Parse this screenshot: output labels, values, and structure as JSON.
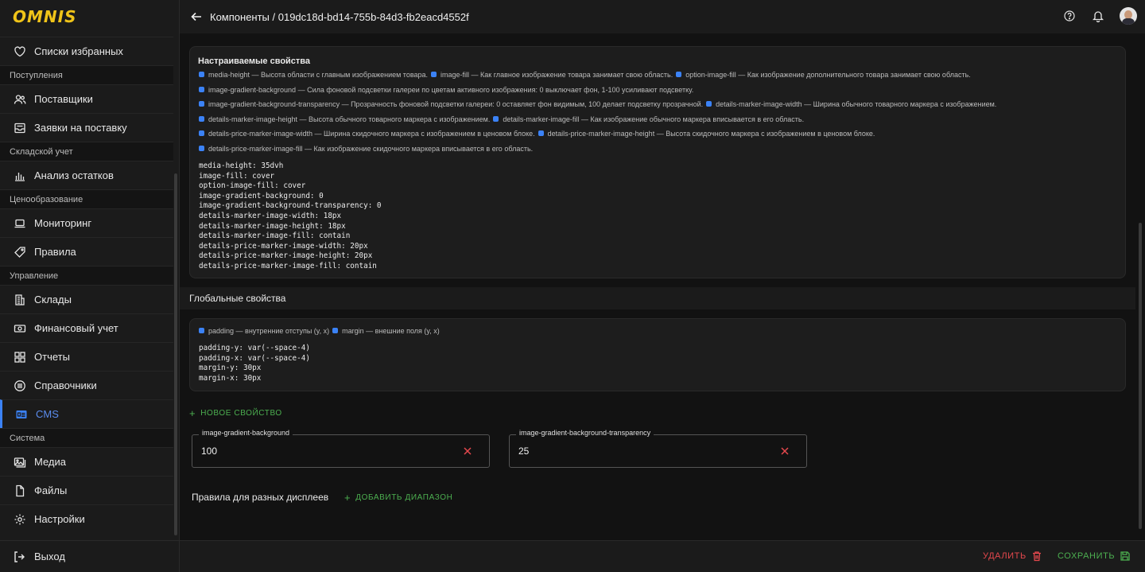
{
  "app": {
    "logo": "OMNIS"
  },
  "header": {
    "breadcrumb": "Компоненты / 019dc18d-bd14-755b-84d3-fb2eacd4552f",
    "icons": [
      "arrow-left-icon",
      "help-icon",
      "bell-icon",
      "avatar"
    ]
  },
  "sidebar": {
    "items": [
      {
        "type": "item",
        "label": "Списки избранных",
        "icon": "heart-icon"
      },
      {
        "type": "section",
        "label": "Поступления"
      },
      {
        "type": "item",
        "label": "Поставщики",
        "icon": "users-icon"
      },
      {
        "type": "item",
        "label": "Заявки на поставку",
        "icon": "inbox-icon"
      },
      {
        "type": "section",
        "label": "Складской учет"
      },
      {
        "type": "item",
        "label": "Анализ остатков",
        "icon": "bar-chart-icon"
      },
      {
        "type": "section",
        "label": "Ценообразование"
      },
      {
        "type": "item",
        "label": "Мониторинг",
        "icon": "laptop-icon"
      },
      {
        "type": "item",
        "label": "Правила",
        "icon": "tag-icon"
      },
      {
        "type": "section",
        "label": "Управление"
      },
      {
        "type": "item",
        "label": "Склады",
        "icon": "building-icon"
      },
      {
        "type": "item",
        "label": "Финансовый учет",
        "icon": "money-icon"
      },
      {
        "type": "item",
        "label": "Отчеты",
        "icon": "grid-icon"
      },
      {
        "type": "item",
        "label": "Справочники",
        "icon": "list-circle-icon"
      },
      {
        "type": "item",
        "label": "CMS",
        "icon": "cms-icon",
        "active": true
      },
      {
        "type": "section",
        "label": "Система"
      },
      {
        "type": "item",
        "label": "Медиа",
        "icon": "image-icon"
      },
      {
        "type": "item",
        "label": "Файлы",
        "icon": "file-icon"
      },
      {
        "type": "item",
        "label": "Настройки",
        "icon": "gear-icon"
      }
    ],
    "logout": "Выход"
  },
  "custom_props": {
    "title": "Настраиваемые свойства",
    "legend_rows": [
      [
        "media-height — Высота области с главным изображением товара.",
        "image-fill — Как главное изображение товара занимает свою область.",
        "option-image-fill — Как изображение дополнительного товара занимает свою область."
      ],
      [
        "image-gradient-background — Сила фоновой подсветки галереи по цветам активного изображения: 0 выключает фон, 1-100 усиливают подсветку."
      ],
      [
        "image-gradient-background-transparency — Прозрачность фоновой подсветки галереи: 0 оставляет фон видимым, 100 делает подсветку прозрачной.",
        "details-marker-image-width — Ширина обычного товарного маркера с изображением."
      ],
      [
        "details-marker-image-height — Высота обычного товарного маркера с изображением.",
        "details-marker-image-fill — Как изображение обычного маркера вписывается в его область."
      ],
      [
        "details-price-marker-image-width — Ширина скидочного маркера с изображением в ценовом блоке.",
        "details-price-marker-image-height — Высота скидочного маркера с изображением в ценовом блоке."
      ],
      [
        "details-price-marker-image-fill — Как изображение скидочного маркера вписывается в его область."
      ]
    ],
    "code": "media-height: 35dvh\nimage-fill: cover\noption-image-fill: cover\nimage-gradient-background: 0\nimage-gradient-background-transparency: 0\ndetails-marker-image-width: 18px\ndetails-marker-image-height: 18px\ndetails-marker-image-fill: contain\ndetails-price-marker-image-width: 20px\ndetails-price-marker-image-height: 20px\ndetails-price-marker-image-fill: contain"
  },
  "global_props": {
    "title": "Глобальные свойства",
    "legend": [
      "padding — внутренние отступы (y, x)",
      "margin — внешние поля (y, x)"
    ],
    "code": "padding-y: var(--space-4)\npadding-x: var(--space-4)\nmargin-y: 30px\nmargin-x: 30px"
  },
  "new_property_label": "НОВОЕ СВОЙСТВО",
  "fields": [
    {
      "label": "image-gradient-background",
      "value": "100"
    },
    {
      "label": "image-gradient-background-transparency",
      "value": "25"
    }
  ],
  "rules": {
    "label": "Правила для разных дисплеев",
    "add_range_label": "ДОБАВИТЬ ДИАПАЗОН"
  },
  "footer": {
    "delete_label": "УДАЛИТЬ",
    "save_label": "СОХРАНИТЬ"
  },
  "colors": {
    "accent": "#3b82f6",
    "success": "#4caf50",
    "danger": "#e5484d",
    "logo": "#f0c419"
  }
}
